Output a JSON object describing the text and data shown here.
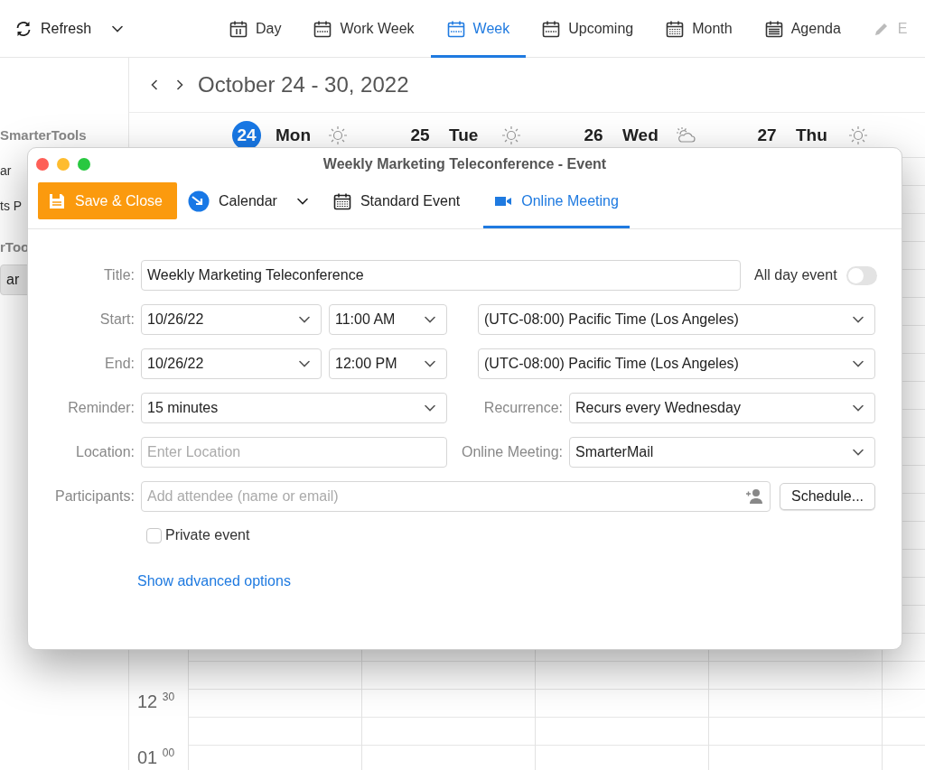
{
  "toolbar": {
    "refresh": {
      "label": "Refresh"
    },
    "views": [
      {
        "label": "Day",
        "kind": "day",
        "selected": false
      },
      {
        "label": "Work Week",
        "kind": "week",
        "selected": false
      },
      {
        "label": "Week",
        "kind": "week",
        "selected": true
      },
      {
        "label": "Upcoming",
        "kind": "week",
        "selected": false
      },
      {
        "label": "Month",
        "kind": "month",
        "selected": false
      },
      {
        "label": "Agenda",
        "kind": "agenda",
        "selected": false
      }
    ],
    "edit": {
      "label": "E",
      "disabled": true
    }
  },
  "sidebar": {
    "items": [
      {
        "label": "SmarterTools",
        "kind": "heading",
        "selected": false
      },
      {
        "label": "ar",
        "kind": "item",
        "selected": false
      },
      {
        "label": "ts P",
        "kind": "item",
        "selected": false
      },
      {
        "label": "rToo",
        "kind": "heading",
        "selected": false
      },
      {
        "label": "ar",
        "kind": "item",
        "selected": true
      }
    ]
  },
  "calendar": {
    "range": "October 24 - 30, 2022",
    "days": [
      {
        "date": "24",
        "name": "Mon",
        "today": true,
        "kind": "sun"
      },
      {
        "date": "25",
        "name": "Tue",
        "today": false,
        "kind": "sun"
      },
      {
        "date": "26",
        "name": "Wed",
        "today": false,
        "kind": "cloud"
      },
      {
        "date": "27",
        "name": "Thu",
        "today": false,
        "kind": "sun"
      }
    ],
    "time_slots": [
      "12 $^{30}$",
      "01 $^{00}$"
    ]
  },
  "dialog": {
    "title": "Weekly Marketing Teleconference - Event",
    "save_button": "Save & Close",
    "calendar_menu": "Calendar",
    "tabs": [
      {
        "label": "Standard Event",
        "kind": "calendar",
        "selected": false
      },
      {
        "label": "Online Meeting",
        "kind": "video",
        "selected": true
      }
    ],
    "form": {
      "title": {
        "label": "Title:",
        "value": "Weekly Marketing Teleconference"
      },
      "all_day": {
        "label": "All day event",
        "on": false
      },
      "start": {
        "label": "Start:",
        "date": "10/26/22",
        "time": "11:00 AM",
        "timezone": "(UTC-08:00) Pacific Time (Los Angeles)"
      },
      "end": {
        "label": "End:",
        "date": "10/26/22",
        "time": "12:00 PM",
        "timezone": "(UTC-08:00) Pacific Time (Los Angeles)"
      },
      "reminder": {
        "label": "Reminder:",
        "value": "15 minutes"
      },
      "recurrence": {
        "label": "Recurrence:",
        "value": "Recurs every Wednesday"
      },
      "location": {
        "label": "Location:",
        "placeholder": "Enter Location"
      },
      "online_meeting": {
        "label": "Online Meeting:",
        "value": "SmarterMail"
      },
      "participants": {
        "label": "Participants:",
        "placeholder": "Add attendee (name or email)"
      },
      "schedule_button": "Schedule...",
      "private_event": {
        "label": "Private event",
        "checked": false
      },
      "advanced_link": "Show advanced options"
    }
  }
}
